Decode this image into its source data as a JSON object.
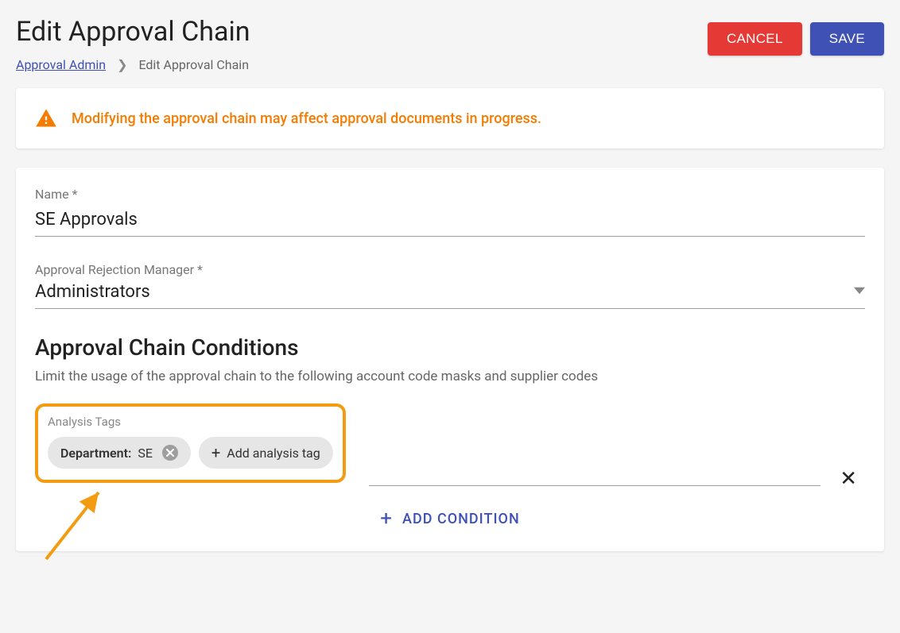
{
  "header": {
    "title": "Edit Approval Chain",
    "breadcrumb_link": "Approval Admin",
    "breadcrumb_current": "Edit Approval Chain",
    "cancel_label": "CANCEL",
    "save_label": "SAVE"
  },
  "warning": {
    "text": "Modifying the approval chain may affect approval documents in progress."
  },
  "form": {
    "name_label": "Name *",
    "name_value": "SE Approvals",
    "rejection_label": "Approval Rejection Manager *",
    "rejection_value": "Administrators"
  },
  "conditions": {
    "title": "Approval Chain Conditions",
    "subtitle": "Limit the usage of the approval chain to the following account code masks and supplier codes",
    "tags_label": "Analysis Tags",
    "tag_key": "Department:",
    "tag_val": "SE",
    "add_tag_label": "Add analysis tag",
    "add_condition_label": "ADD CONDITION"
  }
}
